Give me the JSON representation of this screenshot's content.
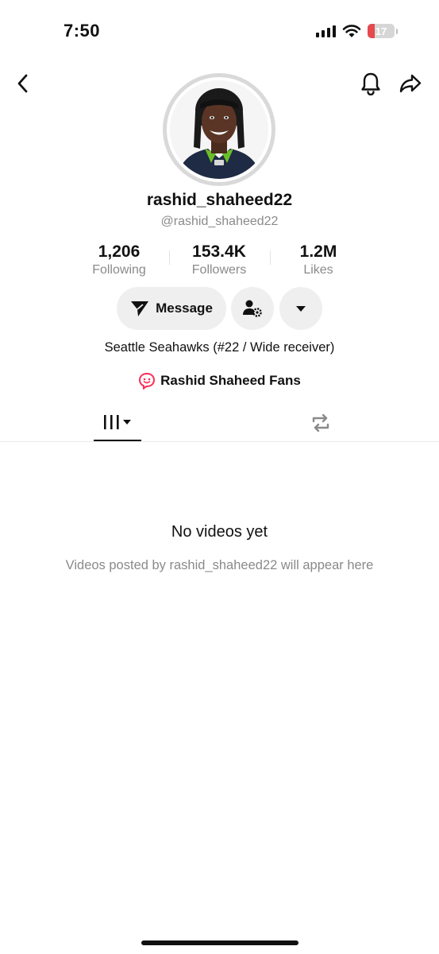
{
  "status_bar": {
    "time": "7:50",
    "battery_level": "17",
    "battery_color": "#e5484d"
  },
  "nav": {
    "back_icon": "chevron-left-icon",
    "bell_icon": "bell-icon",
    "share_icon": "share-arrow-icon"
  },
  "profile": {
    "display_name": "rashid_shaheed22",
    "handle": "@rashid_shaheed22",
    "stats": [
      {
        "value": "1,206",
        "label": "Following"
      },
      {
        "value": "153.4K",
        "label": "Followers"
      },
      {
        "value": "1.2M",
        "label": "Likes"
      }
    ],
    "bio": "Seattle Seahawks (#22 / Wide receiver)",
    "fan_group": "Rashid Shaheed Fans",
    "fan_icon_color": "#fe2c55"
  },
  "actions": {
    "message_label": "Message",
    "message_icon": "paper-plane-icon",
    "follow_settings_icon": "user-gear-icon",
    "more_icon": "caret-down-icon"
  },
  "tabs": {
    "videos_icon": "grid-lines-icon",
    "reposts_icon": "repost-icon"
  },
  "empty_state": {
    "title": "No videos yet",
    "subtitle": "Videos posted by rashid_shaheed22 will appear here"
  }
}
